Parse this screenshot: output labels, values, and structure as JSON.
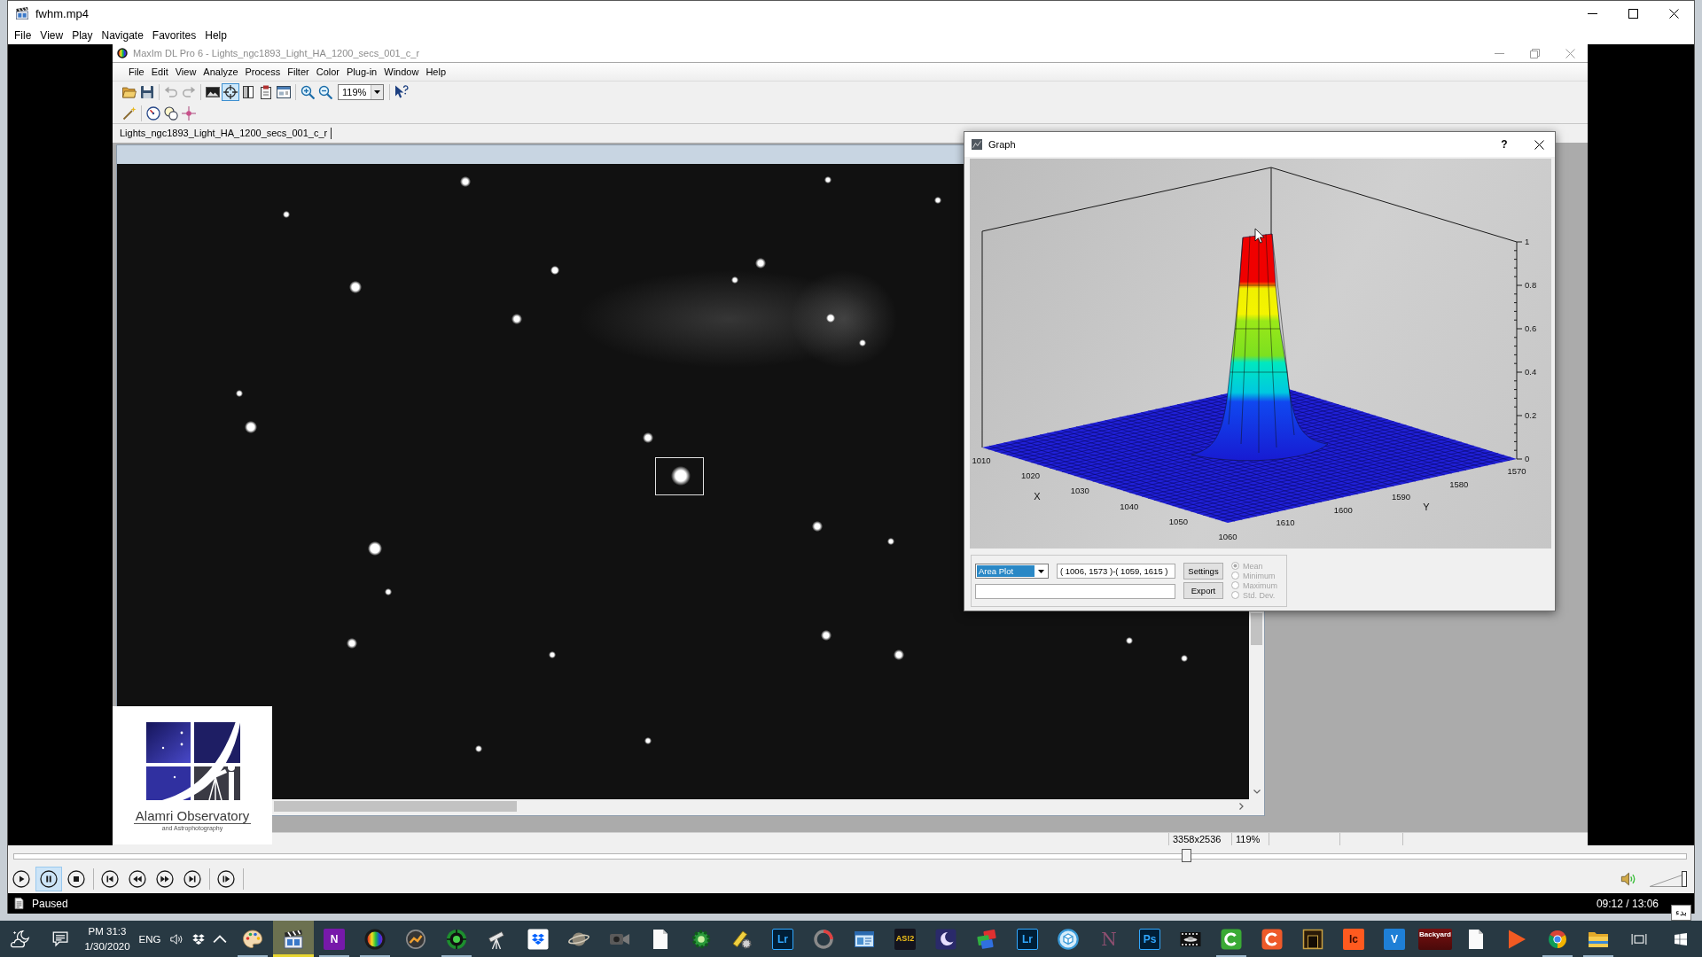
{
  "player": {
    "title": "fwhm.mp4",
    "menu": [
      "File",
      "View",
      "Play",
      "Navigate",
      "Favorites",
      "Help"
    ],
    "seek": {
      "level": 0.702
    },
    "control_groups": [
      [
        {
          "kind": "play",
          "selected": false
        },
        {
          "kind": "pause",
          "selected": true
        },
        {
          "kind": "stop",
          "selected": false
        }
      ],
      [
        {
          "kind": "skipback",
          "selected": false
        },
        {
          "kind": "rewind",
          "selected": false
        },
        {
          "kind": "forward",
          "selected": false
        },
        {
          "kind": "skipforward",
          "selected": false
        }
      ],
      [
        {
          "kind": "framestep",
          "selected": false
        }
      ]
    ],
    "volume": {
      "level": 1
    },
    "status": "Paused",
    "time": "09:12 / 13:06"
  },
  "maxim": {
    "title": "MaxIm DL Pro 6 - Lights_ngc1893_Light_HA_1200_secs_001_c_r",
    "active": false,
    "menu": [
      "File",
      "Edit",
      "View",
      "Analyze",
      "Process",
      "Filter",
      "Color",
      "Plug-in",
      "Window",
      "Help"
    ],
    "toolbar": [
      [
        {
          "kind": "folder",
          "selected": false,
          "disabled": false
        },
        {
          "kind": "floppy",
          "selected": false,
          "disabled": false
        }
      ],
      [
        {
          "kind": "undo",
          "selected": false,
          "disabled": true
        },
        {
          "kind": "redo",
          "selected": false,
          "disabled": true
        }
      ],
      [
        {
          "kind": "picture",
          "selected": false,
          "disabled": false
        },
        {
          "kind": "crosshair",
          "selected": true,
          "disabled": false
        },
        {
          "kind": "columns",
          "selected": false,
          "disabled": false
        },
        {
          "kind": "clipboard",
          "selected": false,
          "disabled": false
        },
        {
          "kind": "dialog",
          "selected": false,
          "disabled": false
        }
      ],
      [
        {
          "kind": "zoomin",
          "selected": false,
          "disabled": false
        },
        {
          "kind": "zoomout",
          "selected": false,
          "disabled": false
        },
        {
          "kind": "combo",
          "value": "119%"
        }
      ],
      [
        {
          "kind": "helppointer",
          "selected": false,
          "disabled": false
        }
      ]
    ],
    "toolbar_2": [
      [
        {
          "kind": "wand",
          "selected": false,
          "disabled": false
        }
      ],
      [
        {
          "kind": "gauge",
          "selected": false,
          "disabled": false
        },
        {
          "kind": "circles",
          "selected": false,
          "disabled": false
        },
        {
          "kind": "starmarker",
          "selected": false,
          "disabled": false
        }
      ]
    ],
    "document_tab": "Lights_ngc1893_Light_HA_1200_secs_001_c_r",
    "status_bar": [
      "3358x2536",
      "119%"
    ]
  },
  "logo": {
    "name": "Alamri Observatory",
    "tagline": "and Astrophotography"
  },
  "graph": {
    "title": "Graph",
    "help": "?",
    "plot": {
      "z_ticks": [
        "1",
        "0.8",
        "0.6",
        "0.4",
        "0.2",
        "0"
      ],
      "x_ticks": [
        "1010",
        "1020",
        "1030",
        "1040",
        "1050",
        "1060"
      ],
      "y_ticks": [
        "1610",
        "1600",
        "1590",
        "1580",
        "1570"
      ],
      "x_title": "X",
      "y_title": "Y"
    },
    "plot_type": {
      "value": "Area Plot",
      "focused": true
    },
    "region": "( 1006, 1573 )-( 1059, 1615 )",
    "buttons": [
      "Settings",
      "Export"
    ],
    "statistics": [
      {
        "label": "Mean",
        "selected": true,
        "disabled": true
      },
      {
        "label": "Minimum",
        "selected": false,
        "disabled": true
      },
      {
        "label": "Maximum",
        "selected": false,
        "disabled": true
      },
      {
        "label": "Std. Dev.",
        "selected": false,
        "disabled": true
      }
    ]
  },
  "tooltip": "بدء",
  "taskbar": {
    "time": "PM 31:3",
    "date": "1/30/2020",
    "language": "ENG",
    "apps": [
      {
        "kind": "palette",
        "running": true,
        "selected": false
      },
      {
        "kind": "clapper",
        "running": true,
        "selected": true
      },
      {
        "kind": "notebook",
        "label": "N",
        "running": true,
        "selected": false
      },
      {
        "kind": "spectrum",
        "running": true,
        "selected": false
      },
      {
        "kind": "zigzag",
        "running": false,
        "selected": false
      },
      {
        "kind": "target",
        "running": true,
        "selected": false
      },
      {
        "kind": "telescope",
        "running": false,
        "selected": false
      },
      {
        "kind": "diamonds",
        "running": false,
        "selected": false
      },
      {
        "kind": "planet",
        "running": false,
        "selected": false
      },
      {
        "kind": "camera",
        "running": false,
        "selected": false
      },
      {
        "kind": "page",
        "running": false,
        "selected": false
      },
      {
        "kind": "gear",
        "running": false,
        "selected": false
      },
      {
        "kind": "tool",
        "running": false,
        "selected": false
      },
      {
        "kind": "lr",
        "label": "Lr",
        "running": false,
        "selected": false
      },
      {
        "kind": "ring",
        "running": false,
        "selected": false
      },
      {
        "kind": "window",
        "running": false,
        "selected": false
      },
      {
        "kind": "asi",
        "label": "AS!2",
        "running": false,
        "selected": false
      },
      {
        "kind": "moon",
        "running": false,
        "selected": false
      },
      {
        "kind": "cards",
        "running": false,
        "selected": false
      },
      {
        "kind": "lr",
        "label": "Lr",
        "running": false,
        "selected": false
      },
      {
        "kind": "cube",
        "running": false,
        "selected": false
      },
      {
        "kind": "nebula",
        "label": "N",
        "running": false,
        "selected": false
      },
      {
        "kind": "ps",
        "label": "Ps",
        "running": false,
        "selected": false
      },
      {
        "kind": "film",
        "running": false,
        "selected": false
      },
      {
        "kind": "greenarc",
        "running": true,
        "selected": false
      },
      {
        "kind": "orangearc",
        "running": false,
        "selected": false
      },
      {
        "kind": "door",
        "running": false,
        "selected": false
      },
      {
        "kind": "ic",
        "label": "Ic",
        "running": false,
        "selected": false
      },
      {
        "kind": "v",
        "label": "V",
        "running": false,
        "selected": false
      },
      {
        "kind": "backyard",
        "label": "Backyard",
        "running": false,
        "selected": false
      },
      {
        "kind": "page",
        "running": false,
        "selected": false
      },
      {
        "kind": "play",
        "running": false,
        "selected": false
      },
      {
        "kind": "browser",
        "running": true,
        "selected": false
      },
      {
        "kind": "folder",
        "running": true,
        "selected": false
      }
    ]
  }
}
